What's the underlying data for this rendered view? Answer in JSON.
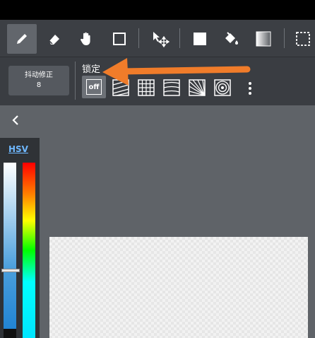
{
  "toolbar": {
    "tools": [
      {
        "name": "pen",
        "icon": "pen-icon",
        "active": true
      },
      {
        "name": "eraser",
        "icon": "eraser-icon"
      },
      {
        "name": "hand",
        "icon": "hand-icon"
      },
      {
        "name": "shape",
        "icon": "square-icon"
      },
      {
        "name": "move",
        "icon": "move-icon"
      },
      {
        "name": "fill-rect",
        "icon": "filled-square-icon"
      },
      {
        "name": "bucket",
        "icon": "bucket-icon"
      },
      {
        "name": "gradient",
        "icon": "gradient-icon"
      },
      {
        "name": "select",
        "icon": "selection-icon"
      }
    ]
  },
  "stabilizer": {
    "label": "抖动修正",
    "value": "8"
  },
  "lock": {
    "title": "锁定",
    "off_label": "off",
    "rulers": [
      "off-icon",
      "parallel-lines-icon",
      "grid-icon",
      "perspective-icon",
      "radial-icon",
      "concentric-icon"
    ]
  },
  "color_panel": {
    "mode_label": "HSV",
    "value_level": 0.62
  },
  "colors": {
    "accent": "#6fb8ff",
    "arrow": "#f07c2a"
  }
}
